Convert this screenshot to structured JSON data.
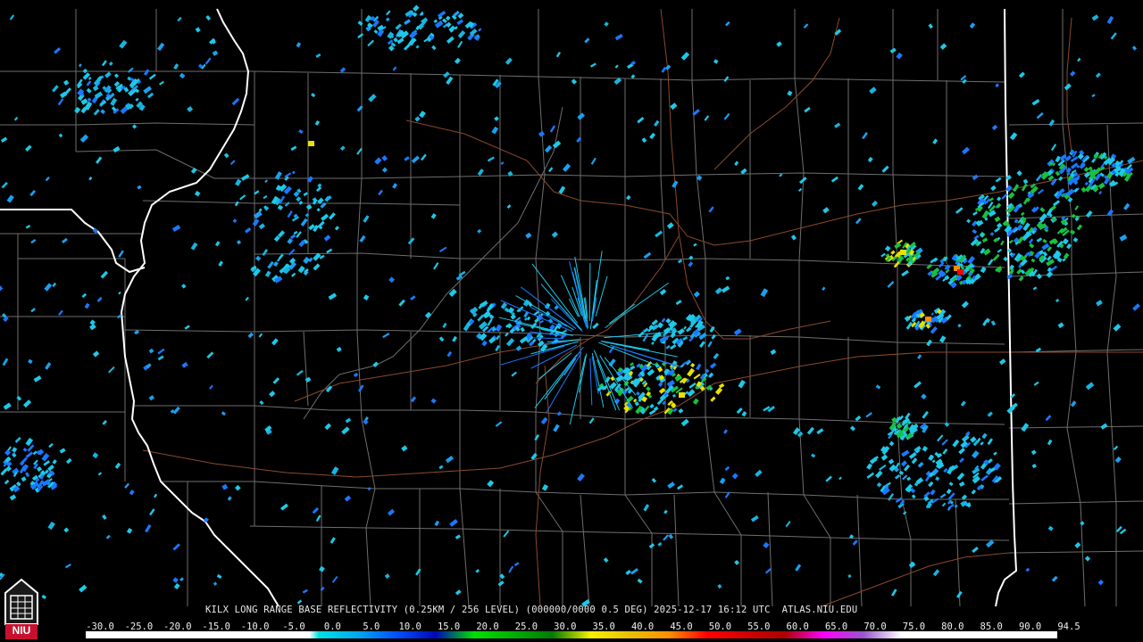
{
  "product": {
    "caption": "KILX LONG RANGE BASE REFLECTIVITY (0.25KM / 256 LEVEL) (000000/0000 0.5 DEG) 2025-12-17 16:12 UTC  ATLAS.NIU.EDU"
  },
  "logo": {
    "text": "NIU",
    "icon": "niu-logo-icon"
  },
  "scale": {
    "labels": [
      "-30.0",
      "-25.0",
      "-20.0",
      "-15.0",
      "-10.0",
      "-5.0",
      "0.0",
      "5.0",
      "10.0",
      "15.0",
      "20.0",
      "25.0",
      "30.0",
      "35.0",
      "40.0",
      "45.0",
      "50.0",
      "55.0",
      "60.0",
      "65.0",
      "70.0",
      "75.0",
      "80.0",
      "85.0",
      "90.0",
      "94.5"
    ],
    "colors": [
      "#ffffff",
      "#ffffff",
      "#ffffff",
      "#ffffff",
      "#ffffff",
      "#ffffff",
      "#00d8d8",
      "#00a0f0",
      "#0050ff",
      "#0010c0",
      "#00e000",
      "#00b000",
      "#008000",
      "#f8f000",
      "#e8c000",
      "#ff9000",
      "#ff0000",
      "#d00000",
      "#b00000",
      "#ff00ff",
      "#9955cc",
      "#ffffff",
      "#ffffff",
      "#ffffff",
      "#ffffff",
      "#ffffff"
    ]
  },
  "colors": {
    "background": "#000000",
    "county_lines": "#707070",
    "state_lines": "#ffffff",
    "highways": "#8b4a2b",
    "echo_light_blue": "#1ec8e8",
    "echo_blue": "#1a78ff",
    "echo_green": "#18c040",
    "echo_yellow": "#e8e000",
    "echo_orange": "#ff8a00"
  }
}
